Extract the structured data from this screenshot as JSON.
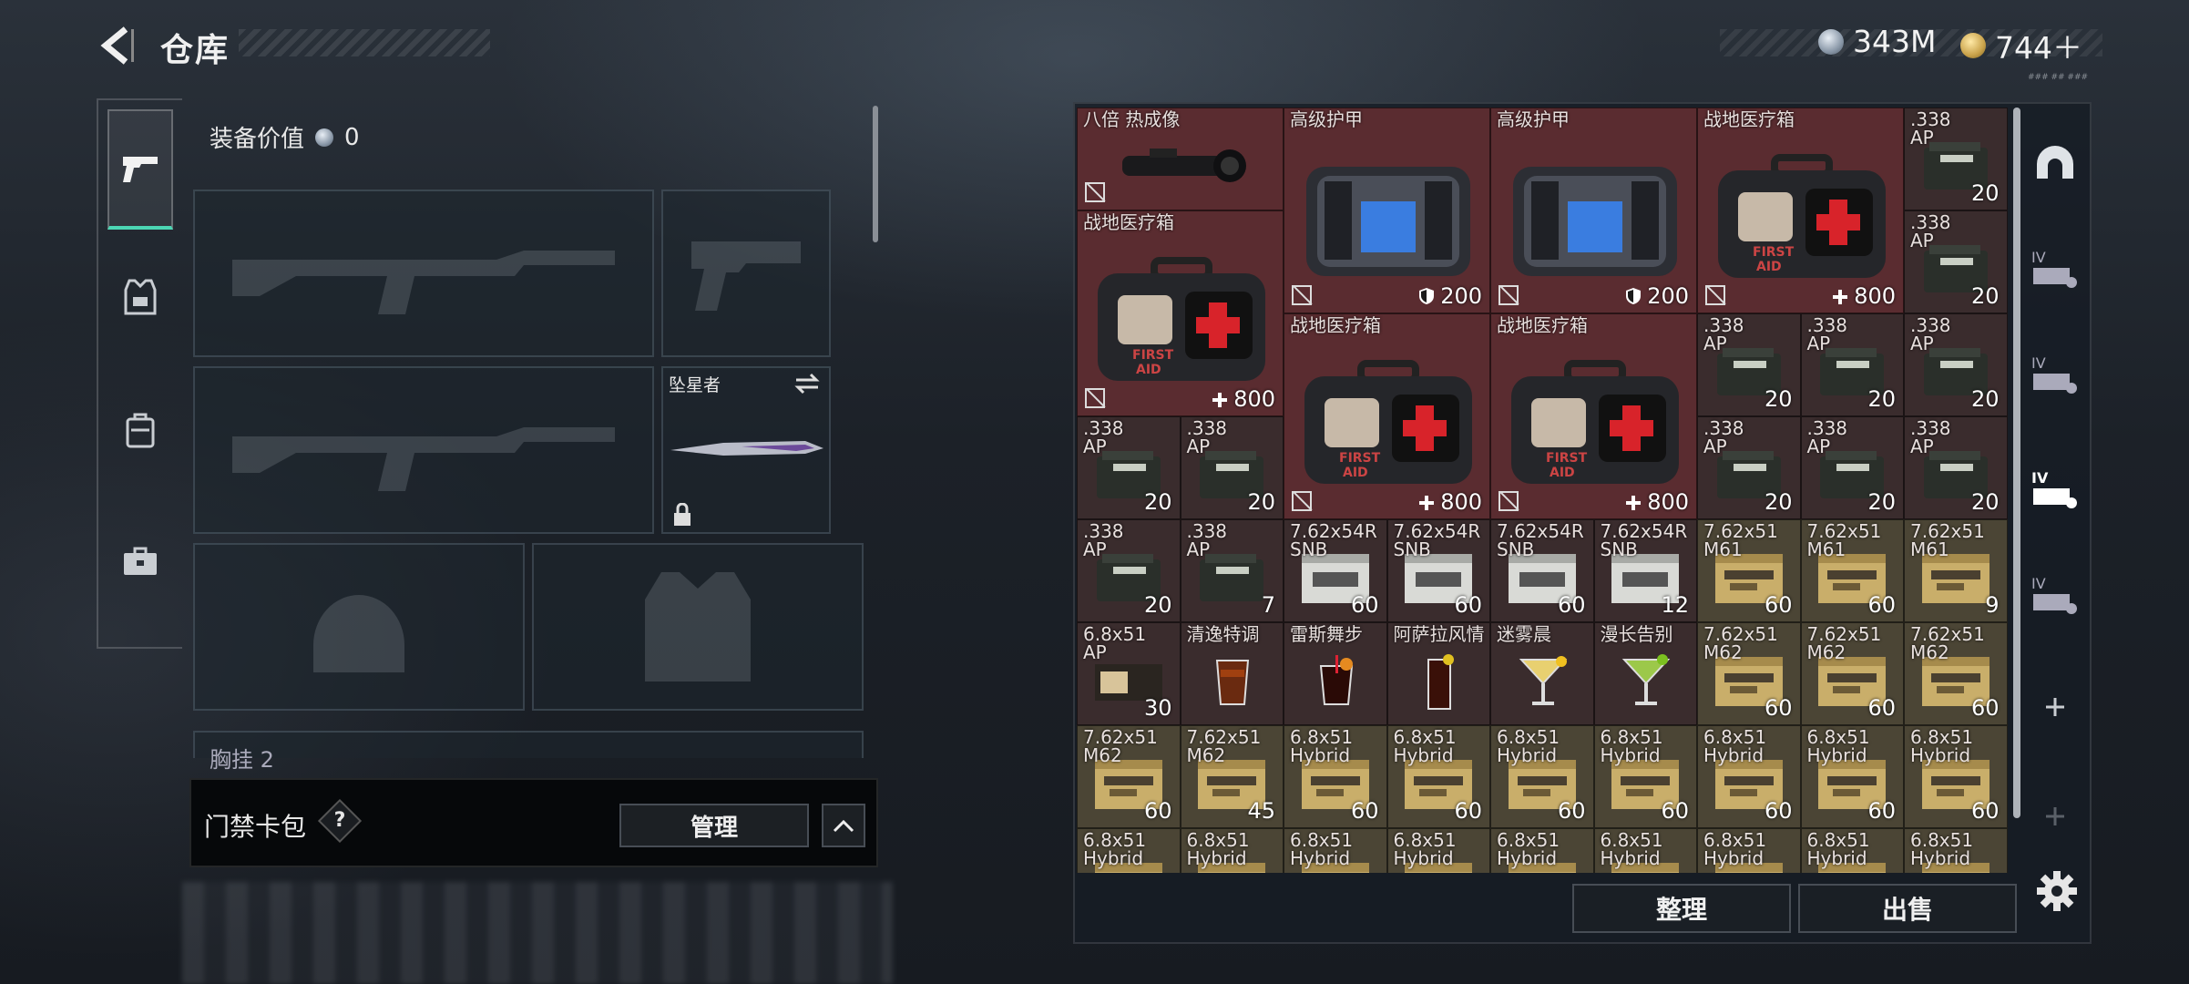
{
  "header": {
    "title": "仓库",
    "silver": "343M",
    "gold": "744＋",
    "version": "###  ##  ###"
  },
  "tabs": [
    {
      "icon": "pistol-icon",
      "active": true
    },
    {
      "icon": "armor-vest-icon"
    },
    {
      "icon": "backpack-icon"
    },
    {
      "icon": "toolbox-icon"
    }
  ],
  "loadout": {
    "value_label": "装备价值",
    "value": "0",
    "melee_name": "坠星者",
    "hook_label": "胸挂",
    "hook_value": "2"
  },
  "access": {
    "label": "门禁卡包",
    "help": "?",
    "manage": "管理"
  },
  "buttons": {
    "sort": "整理",
    "sell": "出售"
  },
  "items": [
    {
      "name": "八倍 热成像",
      "c": 0,
      "r": 0,
      "w": 2,
      "h": 1,
      "bg": "red",
      "art": "scope",
      "nosell": true,
      "qty": ""
    },
    {
      "name": "高级护甲",
      "c": 2,
      "r": 0,
      "w": 2,
      "h": 2,
      "bg": "red",
      "art": "armor",
      "nosell": true,
      "qty": "200",
      "qicon": "shield"
    },
    {
      "name": "高级护甲",
      "c": 4,
      "r": 0,
      "w": 2,
      "h": 2,
      "bg": "red",
      "art": "armor",
      "nosell": true,
      "qty": "200",
      "qicon": "shield"
    },
    {
      "name": "战地医疗箱",
      "c": 6,
      "r": 0,
      "w": 2,
      "h": 2,
      "bg": "red",
      "art": "medkit",
      "nosell": true,
      "qty": "800",
      "qicon": "plus"
    },
    {
      "name": ".338\nAP",
      "c": 8,
      "r": 0,
      "w": 1,
      "h": 1,
      "bg": "dark",
      "art": "ammo-dark",
      "qty": "20"
    },
    {
      "name": "战地医疗箱",
      "c": 0,
      "r": 1,
      "w": 2,
      "h": 2,
      "bg": "red",
      "art": "medkit",
      "nosell": true,
      "qty": "800",
      "qicon": "plus"
    },
    {
      "name": ".338\nAP",
      "c": 8,
      "r": 1,
      "w": 1,
      "h": 1,
      "bg": "dark",
      "art": "ammo-dark",
      "qty": "20"
    },
    {
      "name": "战地医疗箱",
      "c": 2,
      "r": 2,
      "w": 2,
      "h": 2,
      "bg": "red",
      "art": "medkit",
      "nosell": true,
      "qty": "800",
      "qicon": "plus"
    },
    {
      "name": "战地医疗箱",
      "c": 4,
      "r": 2,
      "w": 2,
      "h": 2,
      "bg": "red",
      "art": "medkit",
      "nosell": true,
      "qty": "800",
      "qicon": "plus"
    },
    {
      "name": ".338\nAP",
      "c": 6,
      "r": 2,
      "w": 1,
      "h": 1,
      "bg": "dark",
      "art": "ammo-dark",
      "qty": "20"
    },
    {
      "name": ".338\nAP",
      "c": 7,
      "r": 2,
      "w": 1,
      "h": 1,
      "bg": "dark",
      "art": "ammo-dark",
      "qty": "20"
    },
    {
      "name": ".338\nAP",
      "c": 8,
      "r": 2,
      "w": 1,
      "h": 1,
      "bg": "dark",
      "art": "ammo-dark",
      "qty": "20"
    },
    {
      "name": ".338\nAP",
      "c": 0,
      "r": 3,
      "w": 1,
      "h": 1,
      "bg": "dark",
      "art": "ammo-dark",
      "qty": "20"
    },
    {
      "name": ".338\nAP",
      "c": 1,
      "r": 3,
      "w": 1,
      "h": 1,
      "bg": "dark",
      "art": "ammo-dark",
      "qty": "20"
    },
    {
      "name": ".338\nAP",
      "c": 6,
      "r": 3,
      "w": 1,
      "h": 1,
      "bg": "dark",
      "art": "ammo-dark",
      "qty": "20"
    },
    {
      "name": ".338\nAP",
      "c": 7,
      "r": 3,
      "w": 1,
      "h": 1,
      "bg": "dark",
      "art": "ammo-dark",
      "qty": "20"
    },
    {
      "name": ".338\nAP",
      "c": 8,
      "r": 3,
      "w": 1,
      "h": 1,
      "bg": "dark",
      "art": "ammo-dark",
      "qty": "20"
    },
    {
      "name": ".338\nAP",
      "c": 0,
      "r": 4,
      "w": 1,
      "h": 1,
      "bg": "dark",
      "art": "ammo-dark",
      "qty": "20"
    },
    {
      "name": ".338\nAP",
      "c": 1,
      "r": 4,
      "w": 1,
      "h": 1,
      "bg": "dark",
      "art": "ammo-dark",
      "qty": "7"
    },
    {
      "name": "7.62x54R\nSNB",
      "c": 2,
      "r": 4,
      "w": 1,
      "h": 1,
      "bg": "dark",
      "art": "ammo-white",
      "qty": "60"
    },
    {
      "name": "7.62x54R\nSNB",
      "c": 3,
      "r": 4,
      "w": 1,
      "h": 1,
      "bg": "dark",
      "art": "ammo-white",
      "qty": "60"
    },
    {
      "name": "7.62x54R\nSNB",
      "c": 4,
      "r": 4,
      "w": 1,
      "h": 1,
      "bg": "dark",
      "art": "ammo-white",
      "qty": "60"
    },
    {
      "name": "7.62x54R\nSNB",
      "c": 5,
      "r": 4,
      "w": 1,
      "h": 1,
      "bg": "dark",
      "art": "ammo-white",
      "qty": "12"
    },
    {
      "name": "7.62x51\nM61",
      "c": 6,
      "r": 4,
      "w": 1,
      "h": 1,
      "bg": "olive",
      "art": "ammo-gold",
      "qty": "60"
    },
    {
      "name": "7.62x51\nM61",
      "c": 7,
      "r": 4,
      "w": 1,
      "h": 1,
      "bg": "olive",
      "art": "ammo-gold",
      "qty": "60"
    },
    {
      "name": "7.62x51\nM61",
      "c": 8,
      "r": 4,
      "w": 1,
      "h": 1,
      "bg": "olive",
      "art": "ammo-gold",
      "qty": "9"
    },
    {
      "name": "6.8x51\nAP",
      "c": 0,
      "r": 5,
      "w": 1,
      "h": 1,
      "bg": "dark",
      "art": "ammo-brown",
      "qty": "30"
    },
    {
      "name": "清逸特调",
      "c": 1,
      "r": 5,
      "w": 1,
      "h": 1,
      "bg": "dark",
      "art": "drink-amber",
      "qty": ""
    },
    {
      "name": "雷斯舞步",
      "c": 2,
      "r": 5,
      "w": 1,
      "h": 1,
      "bg": "dark",
      "art": "drink-cola",
      "qty": ""
    },
    {
      "name": "阿萨拉风情",
      "c": 3,
      "r": 5,
      "w": 1,
      "h": 1,
      "bg": "dark",
      "art": "drink-tall",
      "qty": ""
    },
    {
      "name": "迷雾晨",
      "c": 4,
      "r": 5,
      "w": 1,
      "h": 1,
      "bg": "dark",
      "art": "drink-martini-yellow",
      "qty": ""
    },
    {
      "name": "漫长告别",
      "c": 5,
      "r": 5,
      "w": 1,
      "h": 1,
      "bg": "dark",
      "art": "drink-martini-green",
      "qty": ""
    },
    {
      "name": "7.62x51\nM62",
      "c": 6,
      "r": 5,
      "w": 1,
      "h": 1,
      "bg": "olive",
      "art": "ammo-gold",
      "qty": "60"
    },
    {
      "name": "7.62x51\nM62",
      "c": 7,
      "r": 5,
      "w": 1,
      "h": 1,
      "bg": "olive",
      "art": "ammo-gold",
      "qty": "60"
    },
    {
      "name": "7.62x51\nM62",
      "c": 8,
      "r": 5,
      "w": 1,
      "h": 1,
      "bg": "olive",
      "art": "ammo-gold",
      "qty": "60"
    },
    {
      "name": "7.62x51\nM62",
      "c": 0,
      "r": 6,
      "w": 1,
      "h": 1,
      "bg": "olive",
      "art": "ammo-gold",
      "qty": "60"
    },
    {
      "name": "7.62x51\nM62",
      "c": 1,
      "r": 6,
      "w": 1,
      "h": 1,
      "bg": "olive",
      "art": "ammo-gold",
      "qty": "45"
    },
    {
      "name": "6.8x51\nHybrid",
      "c": 2,
      "r": 6,
      "w": 1,
      "h": 1,
      "bg": "olive",
      "art": "ammo-gold",
      "qty": "60"
    },
    {
      "name": "6.8x51\nHybrid",
      "c": 3,
      "r": 6,
      "w": 1,
      "h": 1,
      "bg": "olive",
      "art": "ammo-gold",
      "qty": "60"
    },
    {
      "name": "6.8x51\nHybrid",
      "c": 4,
      "r": 6,
      "w": 1,
      "h": 1,
      "bg": "olive",
      "art": "ammo-gold",
      "qty": "60"
    },
    {
      "name": "6.8x51\nHybrid",
      "c": 5,
      "r": 6,
      "w": 1,
      "h": 1,
      "bg": "olive",
      "art": "ammo-gold",
      "qty": "60"
    },
    {
      "name": "6.8x51\nHybrid",
      "c": 6,
      "r": 6,
      "w": 1,
      "h": 1,
      "bg": "olive",
      "art": "ammo-gold",
      "qty": "60"
    },
    {
      "name": "6.8x51\nHybrid",
      "c": 7,
      "r": 6,
      "w": 1,
      "h": 1,
      "bg": "olive",
      "art": "ammo-gold",
      "qty": "60"
    },
    {
      "name": "6.8x51\nHybrid",
      "c": 8,
      "r": 6,
      "w": 1,
      "h": 1,
      "bg": "olive",
      "art": "ammo-gold",
      "qty": "60"
    },
    {
      "name": "6.8x51\nHybrid",
      "c": 0,
      "r": 7,
      "w": 1,
      "h": 1,
      "bg": "olive",
      "art": "ammo-gold",
      "qty": ""
    },
    {
      "name": "6.8x51\nHybrid",
      "c": 1,
      "r": 7,
      "w": 1,
      "h": 1,
      "bg": "olive",
      "art": "ammo-gold",
      "qty": ""
    },
    {
      "name": "6.8x51\nHybrid",
      "c": 2,
      "r": 7,
      "w": 1,
      "h": 1,
      "bg": "olive",
      "art": "ammo-gold",
      "qty": ""
    },
    {
      "name": "6.8x51\nHybrid",
      "c": 3,
      "r": 7,
      "w": 1,
      "h": 1,
      "bg": "olive",
      "art": "ammo-gold",
      "qty": ""
    },
    {
      "name": "6.8x51\nHybrid",
      "c": 4,
      "r": 7,
      "w": 1,
      "h": 1,
      "bg": "olive",
      "art": "ammo-gold",
      "qty": ""
    },
    {
      "name": "6.8x51\nHybrid",
      "c": 5,
      "r": 7,
      "w": 1,
      "h": 1,
      "bg": "olive",
      "art": "ammo-gold",
      "qty": ""
    },
    {
      "name": "6.8x51\nHybrid",
      "c": 6,
      "r": 7,
      "w": 1,
      "h": 1,
      "bg": "olive",
      "art": "ammo-gold",
      "qty": ""
    },
    {
      "name": "6.8x51\nHybrid",
      "c": 7,
      "r": 7,
      "w": 1,
      "h": 1,
      "bg": "olive",
      "art": "ammo-gold",
      "qty": ""
    },
    {
      "name": "6.8x51\nHybrid",
      "c": 8,
      "r": 7,
      "w": 1,
      "h": 1,
      "bg": "olive",
      "art": "ammo-gold",
      "qty": ""
    }
  ],
  "side_icons": [
    "dome-icon",
    "storage-iv-icon",
    "storage-iv-icon",
    "storage-iv-active-icon",
    "storage-iv-icon",
    "plus-icon",
    "plus-icon"
  ],
  "colors": {
    "accent": "#4cd6b4",
    "red_cell": "#5a2c30",
    "olive_cell": "#4b4535"
  }
}
